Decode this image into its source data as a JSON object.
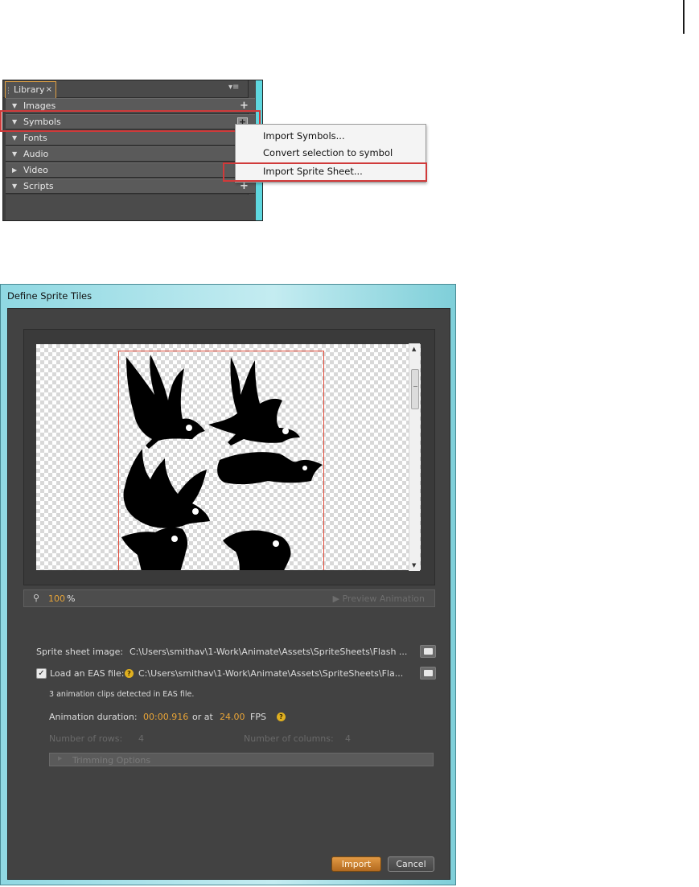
{
  "library": {
    "tab_label": "Library",
    "tab_close": "×",
    "menu_icon": "▾≡",
    "sections": [
      {
        "label": "Images",
        "expanded": true,
        "action": "+"
      },
      {
        "label": "Symbols",
        "expanded": true,
        "action": "+"
      },
      {
        "label": "Fonts",
        "expanded": true,
        "action": ""
      },
      {
        "label": "Audio",
        "expanded": true,
        "action": ""
      },
      {
        "label": "Video",
        "expanded": false,
        "action": ""
      },
      {
        "label": "Scripts",
        "expanded": true,
        "action": "+"
      }
    ],
    "context_menu": [
      "Import Symbols...",
      "Convert selection to symbol",
      "Import Sprite Sheet..."
    ]
  },
  "dialog": {
    "title": "Define Sprite Tiles",
    "zoom_value": "100",
    "zoom_unit": "%",
    "preview_label": "▶ Preview Animation",
    "sprite_sheet_label": "Sprite sheet image:",
    "sprite_sheet_path": "C:\\Users\\smithav\\1-Work\\Animate\\Assets\\SpriteSheets\\Flash ...",
    "eas_checked": true,
    "eas_label": "Load an EAS file:",
    "eas_path": "C:\\Users\\smithav\\1-Work\\Animate\\Assets\\SpriteSheets\\Fla...",
    "detected_text": "3 animation clips detected in EAS file.",
    "duration_label": "Animation duration:",
    "duration_value": "00:00.916",
    "or_at": "or at",
    "fps_value": "24.00",
    "fps_label": "FPS",
    "rows_label": "Number of rows:",
    "rows_value": "4",
    "cols_label": "Number of columns:",
    "cols_value": "4",
    "trimming_label": "Trimming Options",
    "import_label": "Import",
    "cancel_label": "Cancel"
  },
  "colors": {
    "accent_orange": "#e8a437",
    "highlight_red": "#d03a3a",
    "panel_bg": "#424242"
  }
}
